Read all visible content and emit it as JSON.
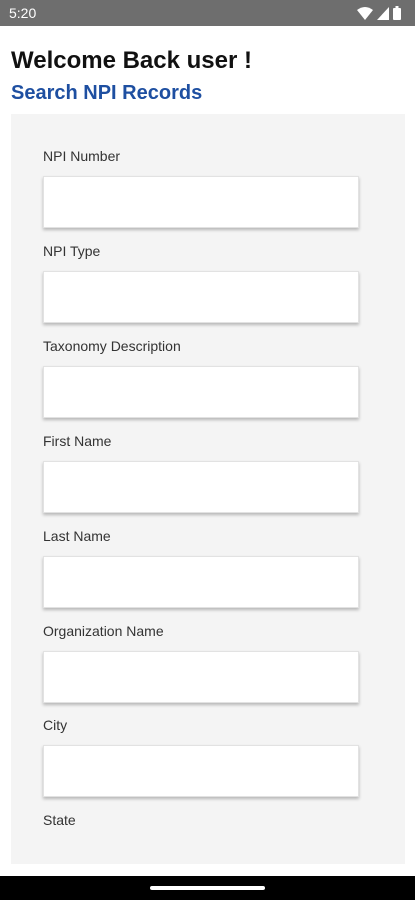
{
  "status_bar": {
    "time": "5:20",
    "icons": [
      "wifi-icon",
      "signal-icon",
      "battery-icon"
    ]
  },
  "header": {
    "welcome": "Welcome Back user !",
    "subtitle": "Search NPI Records"
  },
  "form": {
    "fields": [
      {
        "label": "NPI Number",
        "value": ""
      },
      {
        "label": "NPI Type",
        "value": ""
      },
      {
        "label": "Taxonomy Description",
        "value": ""
      },
      {
        "label": "First Name",
        "value": ""
      },
      {
        "label": "Last Name",
        "value": ""
      },
      {
        "label": "Organization Name",
        "value": ""
      },
      {
        "label": "City",
        "value": ""
      },
      {
        "label": "State"
      }
    ]
  },
  "colors": {
    "status_bar_bg": "#6e6e6e",
    "subtitle": "#1e4fa1",
    "panel_bg": "#f4f4f4"
  }
}
